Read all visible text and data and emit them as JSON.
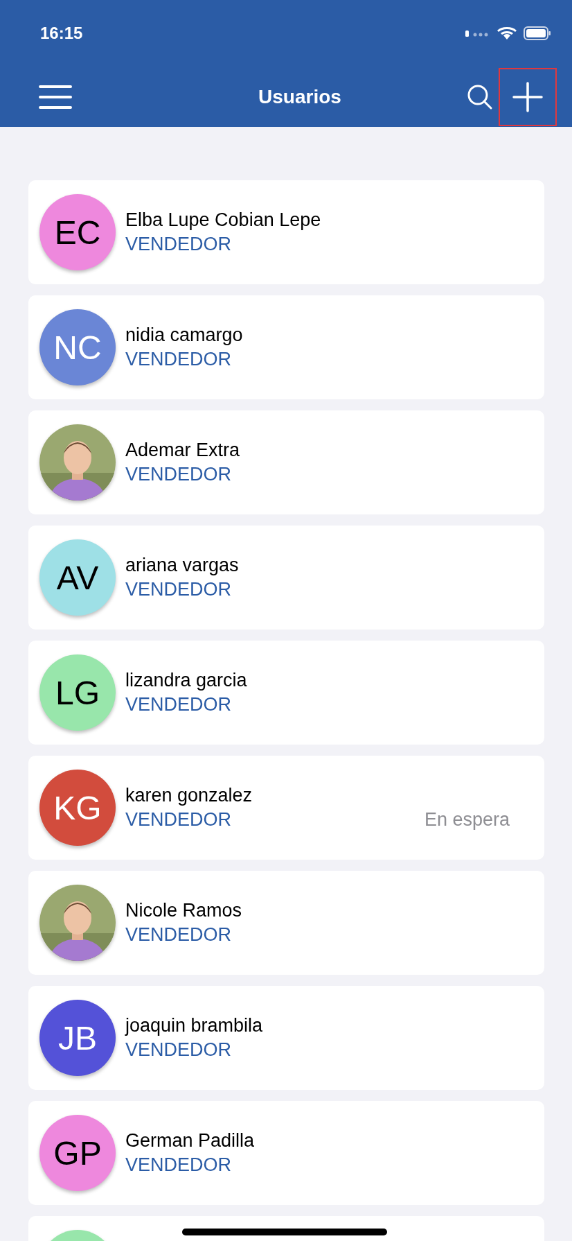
{
  "status_bar": {
    "time": "16:15"
  },
  "nav": {
    "title": "Usuarios",
    "add_highlighted": true
  },
  "users": [
    {
      "kind": "initials",
      "initials": "EC",
      "color": "#ee88dd",
      "name": "Elba Lupe Cobian Lepe",
      "role": "VENDEDOR"
    },
    {
      "kind": "initials",
      "initials": "NC",
      "color": "#6a86d6",
      "name": "nidia camargo",
      "role": "VENDEDOR"
    },
    {
      "name": "Ademar Extra",
      "role": "VENDEDOR"
    },
    {
      "kind": "initials",
      "initials": "AV",
      "color": "#9ee0e6",
      "name": "ariana vargas",
      "role": "VENDEDOR"
    },
    {
      "kind": "initials",
      "initials": "LG",
      "color": "#98e6ab",
      "name": "lizandra garcia",
      "role": "VENDEDOR"
    },
    {
      "kind": "initials",
      "initials": "KG",
      "color": "#d24c3d",
      "name": "karen gonzalez",
      "role": "VENDEDOR",
      "status": "En espera"
    },
    {
      "name": "Nicole Ramos",
      "role": "VENDEDOR"
    },
    {
      "kind": "initials",
      "initials": "JB",
      "color": "#5452d8",
      "name": "joaquin brambila",
      "role": "VENDEDOR"
    },
    {
      "kind": "initials",
      "initials": "GP",
      "color": "#ee88dd",
      "name": "German Padilla",
      "role": "VENDEDOR"
    },
    {
      "kind": "blank",
      "color": "#98e6ab"
    }
  ]
}
